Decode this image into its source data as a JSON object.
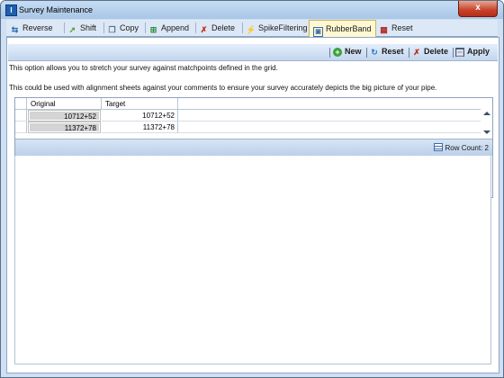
{
  "window": {
    "title": "Survey Maintenance",
    "close_label": "x"
  },
  "tabs": [
    {
      "label": "Reverse",
      "icon": "reverse-arrows-icon"
    },
    {
      "label": "Shift",
      "icon": "shift-arrow-icon"
    },
    {
      "label": "Copy",
      "icon": "copy-icon"
    },
    {
      "label": "Append",
      "icon": "append-icon"
    },
    {
      "label": "Delete",
      "icon": "delete-x-icon"
    },
    {
      "label": "SpikeFiltering",
      "icon": "spike-filter-icon"
    },
    {
      "label": "RubberBand",
      "icon": "rubberband-icon",
      "active": true
    },
    {
      "label": "Reset",
      "icon": "reset-grid-icon"
    }
  ],
  "toolbar": {
    "new_label": "New",
    "reset_label": "Reset",
    "delete_label": "Delete",
    "apply_label": "Apply"
  },
  "info": {
    "line1": "This option allows you to stretch your survey against matchpoints defined in the grid.",
    "line2": "This could be used with alignment sheets against your comments to ensure your survey accurately depicts the big picture of your pipe."
  },
  "grid": {
    "columns": [
      "Original",
      "Target"
    ],
    "rows": [
      {
        "original": "10712+52",
        "target": "10712+52"
      },
      {
        "original": "11372+78",
        "target": "11372+78"
      }
    ]
  },
  "footer": {
    "row_count_label": "Row Count:",
    "row_count": "2"
  },
  "colors": {
    "accent": "#1f5fb0",
    "active_tab": "#fff8d2",
    "close": "#c7422a"
  }
}
